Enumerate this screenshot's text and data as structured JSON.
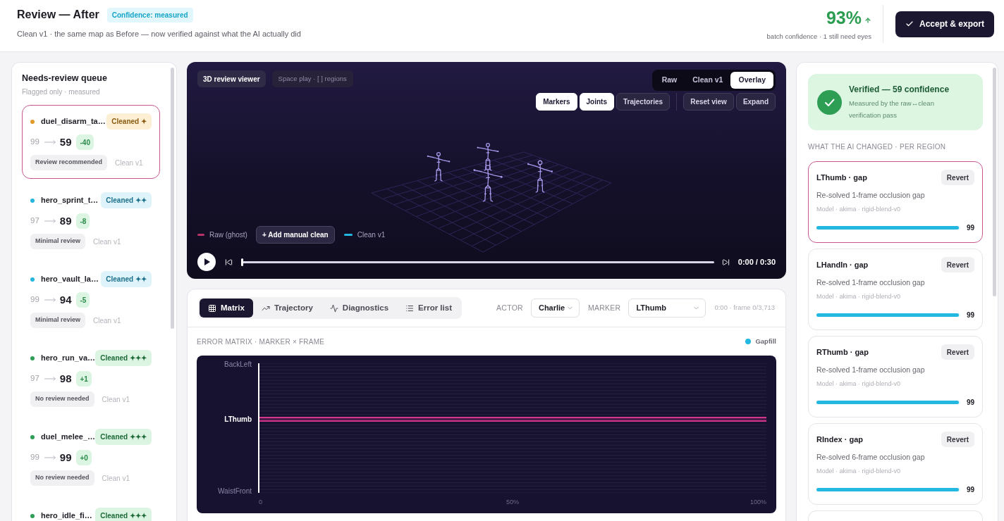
{
  "header": {
    "title": "Review — After",
    "badge": "Confidence: measured",
    "subtitle": "Clean v1 · the same map as Before — now verified against what the AI actually did",
    "score": "93%",
    "score_caption": "batch confidence · 1 still need eyes",
    "action": "Accept & export"
  },
  "queue": {
    "title": "Needs-review queue",
    "subtitle": "Flagged only · measured",
    "items": [
      {
        "name": "duel_disarm_ta…",
        "color": "#e39a2d",
        "kind": "low",
        "badge": "Cleaned ✦",
        "before": "99",
        "after": "59",
        "delta": "-40",
        "review": "Review recommended",
        "version": "Clean v1",
        "selected": true
      },
      {
        "name": "hero_sprint_t…",
        "color": "#27b5e0",
        "kind": "mid",
        "badge": "Cleaned ✦✦",
        "before": "97",
        "after": "89",
        "delta": "-8",
        "review": "Minimal review",
        "version": "Clean v1",
        "selected": false
      },
      {
        "name": "hero_vault_la…",
        "color": "#27b5e0",
        "kind": "mid",
        "badge": "Cleaned ✦✦",
        "before": "99",
        "after": "94",
        "delta": "-5",
        "review": "Minimal review",
        "version": "Clean v1",
        "selected": false
      },
      {
        "name": "hero_run_va…",
        "color": "#2e9e55",
        "kind": "high",
        "badge": "Cleaned ✦✦✦",
        "before": "97",
        "after": "98",
        "delta": "+1",
        "review": "No review needed",
        "version": "Clean v1",
        "selected": false
      },
      {
        "name": "duel_melee_…",
        "color": "#2e9e55",
        "kind": "high",
        "badge": "Cleaned ✦✦✦",
        "before": "99",
        "after": "99",
        "delta": "+0",
        "review": "No review needed",
        "version": "Clean v1",
        "selected": false
      },
      {
        "name": "hero_idle_fi…",
        "color": "#2e9e55",
        "kind": "high",
        "badge": "Cleaned ✦✦✦",
        "selected": false
      }
    ]
  },
  "viewer": {
    "title": "3D review viewer",
    "hint": "Space play · [ ] regions",
    "modes": [
      {
        "label": "Raw",
        "selected": false
      },
      {
        "label": "Clean v1",
        "selected": false
      },
      {
        "label": "Overlay",
        "selected": true
      }
    ],
    "layers": [
      {
        "label": "Markers",
        "on": true
      },
      {
        "label": "Joints",
        "on": true
      },
      {
        "label": "Trajectories",
        "on": false
      }
    ],
    "actions": [
      "Reset view",
      "Expand"
    ],
    "legend": [
      {
        "label": "Raw (ghost)",
        "color": "#b8336a"
      },
      {
        "label": "Clean v1",
        "color": "#22b8e0"
      }
    ],
    "add_button": "+ Add manual clean",
    "playback": {
      "level": 0,
      "time": "0:00 / 0:30"
    }
  },
  "analysis": {
    "tabs": [
      {
        "label": "Matrix",
        "selected": true
      },
      {
        "label": "Trajectory",
        "selected": false
      },
      {
        "label": "Diagnostics",
        "selected": false
      },
      {
        "label": "Error list",
        "selected": false
      }
    ],
    "actor": {
      "label": "ACTOR",
      "value": "Charlie"
    },
    "marker": {
      "label": "MARKER",
      "value": "LThumb"
    },
    "frame": "0:00 · frame 0/3,713",
    "matrix": {
      "title": "ERROR MATRIX · MARKER × FRAME",
      "legend": {
        "label": "Gapfill",
        "color": "#22b8e0"
      },
      "labels": [
        {
          "label": "BackLeft",
          "selected": false
        },
        {
          "label": "LThumb",
          "selected": true
        },
        {
          "label": "WaistFront",
          "selected": false
        }
      ],
      "xticks": [
        "0",
        "50%",
        "100%"
      ]
    }
  },
  "verification": {
    "title": "Verified — 59 confidence",
    "text": "Measured by the raw↔clean verification pass"
  },
  "changes": {
    "title": "WHAT THE AI CHANGED · PER REGION",
    "items": [
      {
        "title": "LThumb · gap",
        "action": "Revert",
        "description": "Re-solved 1-frame occlusion gap",
        "model": "Model · akima · rigid-blend-v0",
        "level": 0.99,
        "score": "99",
        "selected": true
      },
      {
        "title": "LHandIn · gap",
        "action": "Revert",
        "description": "Re-solved 1-frame occlusion gap",
        "model": "Model · akima · rigid-blend-v0",
        "level": 0.99,
        "score": "99",
        "selected": false
      },
      {
        "title": "RThumb · gap",
        "action": "Revert",
        "description": "Re-solved 1-frame occlusion gap",
        "model": "Model · akima · rigid-blend-v0",
        "level": 0.99,
        "score": "99",
        "selected": false
      },
      {
        "title": "RIndex · gap",
        "action": "Revert",
        "description": "Re-solved 6-frame occlusion gap",
        "model": "Model · akima · rigid-blend-v0",
        "level": 0.99,
        "score": "99",
        "selected": false
      }
    ]
  }
}
